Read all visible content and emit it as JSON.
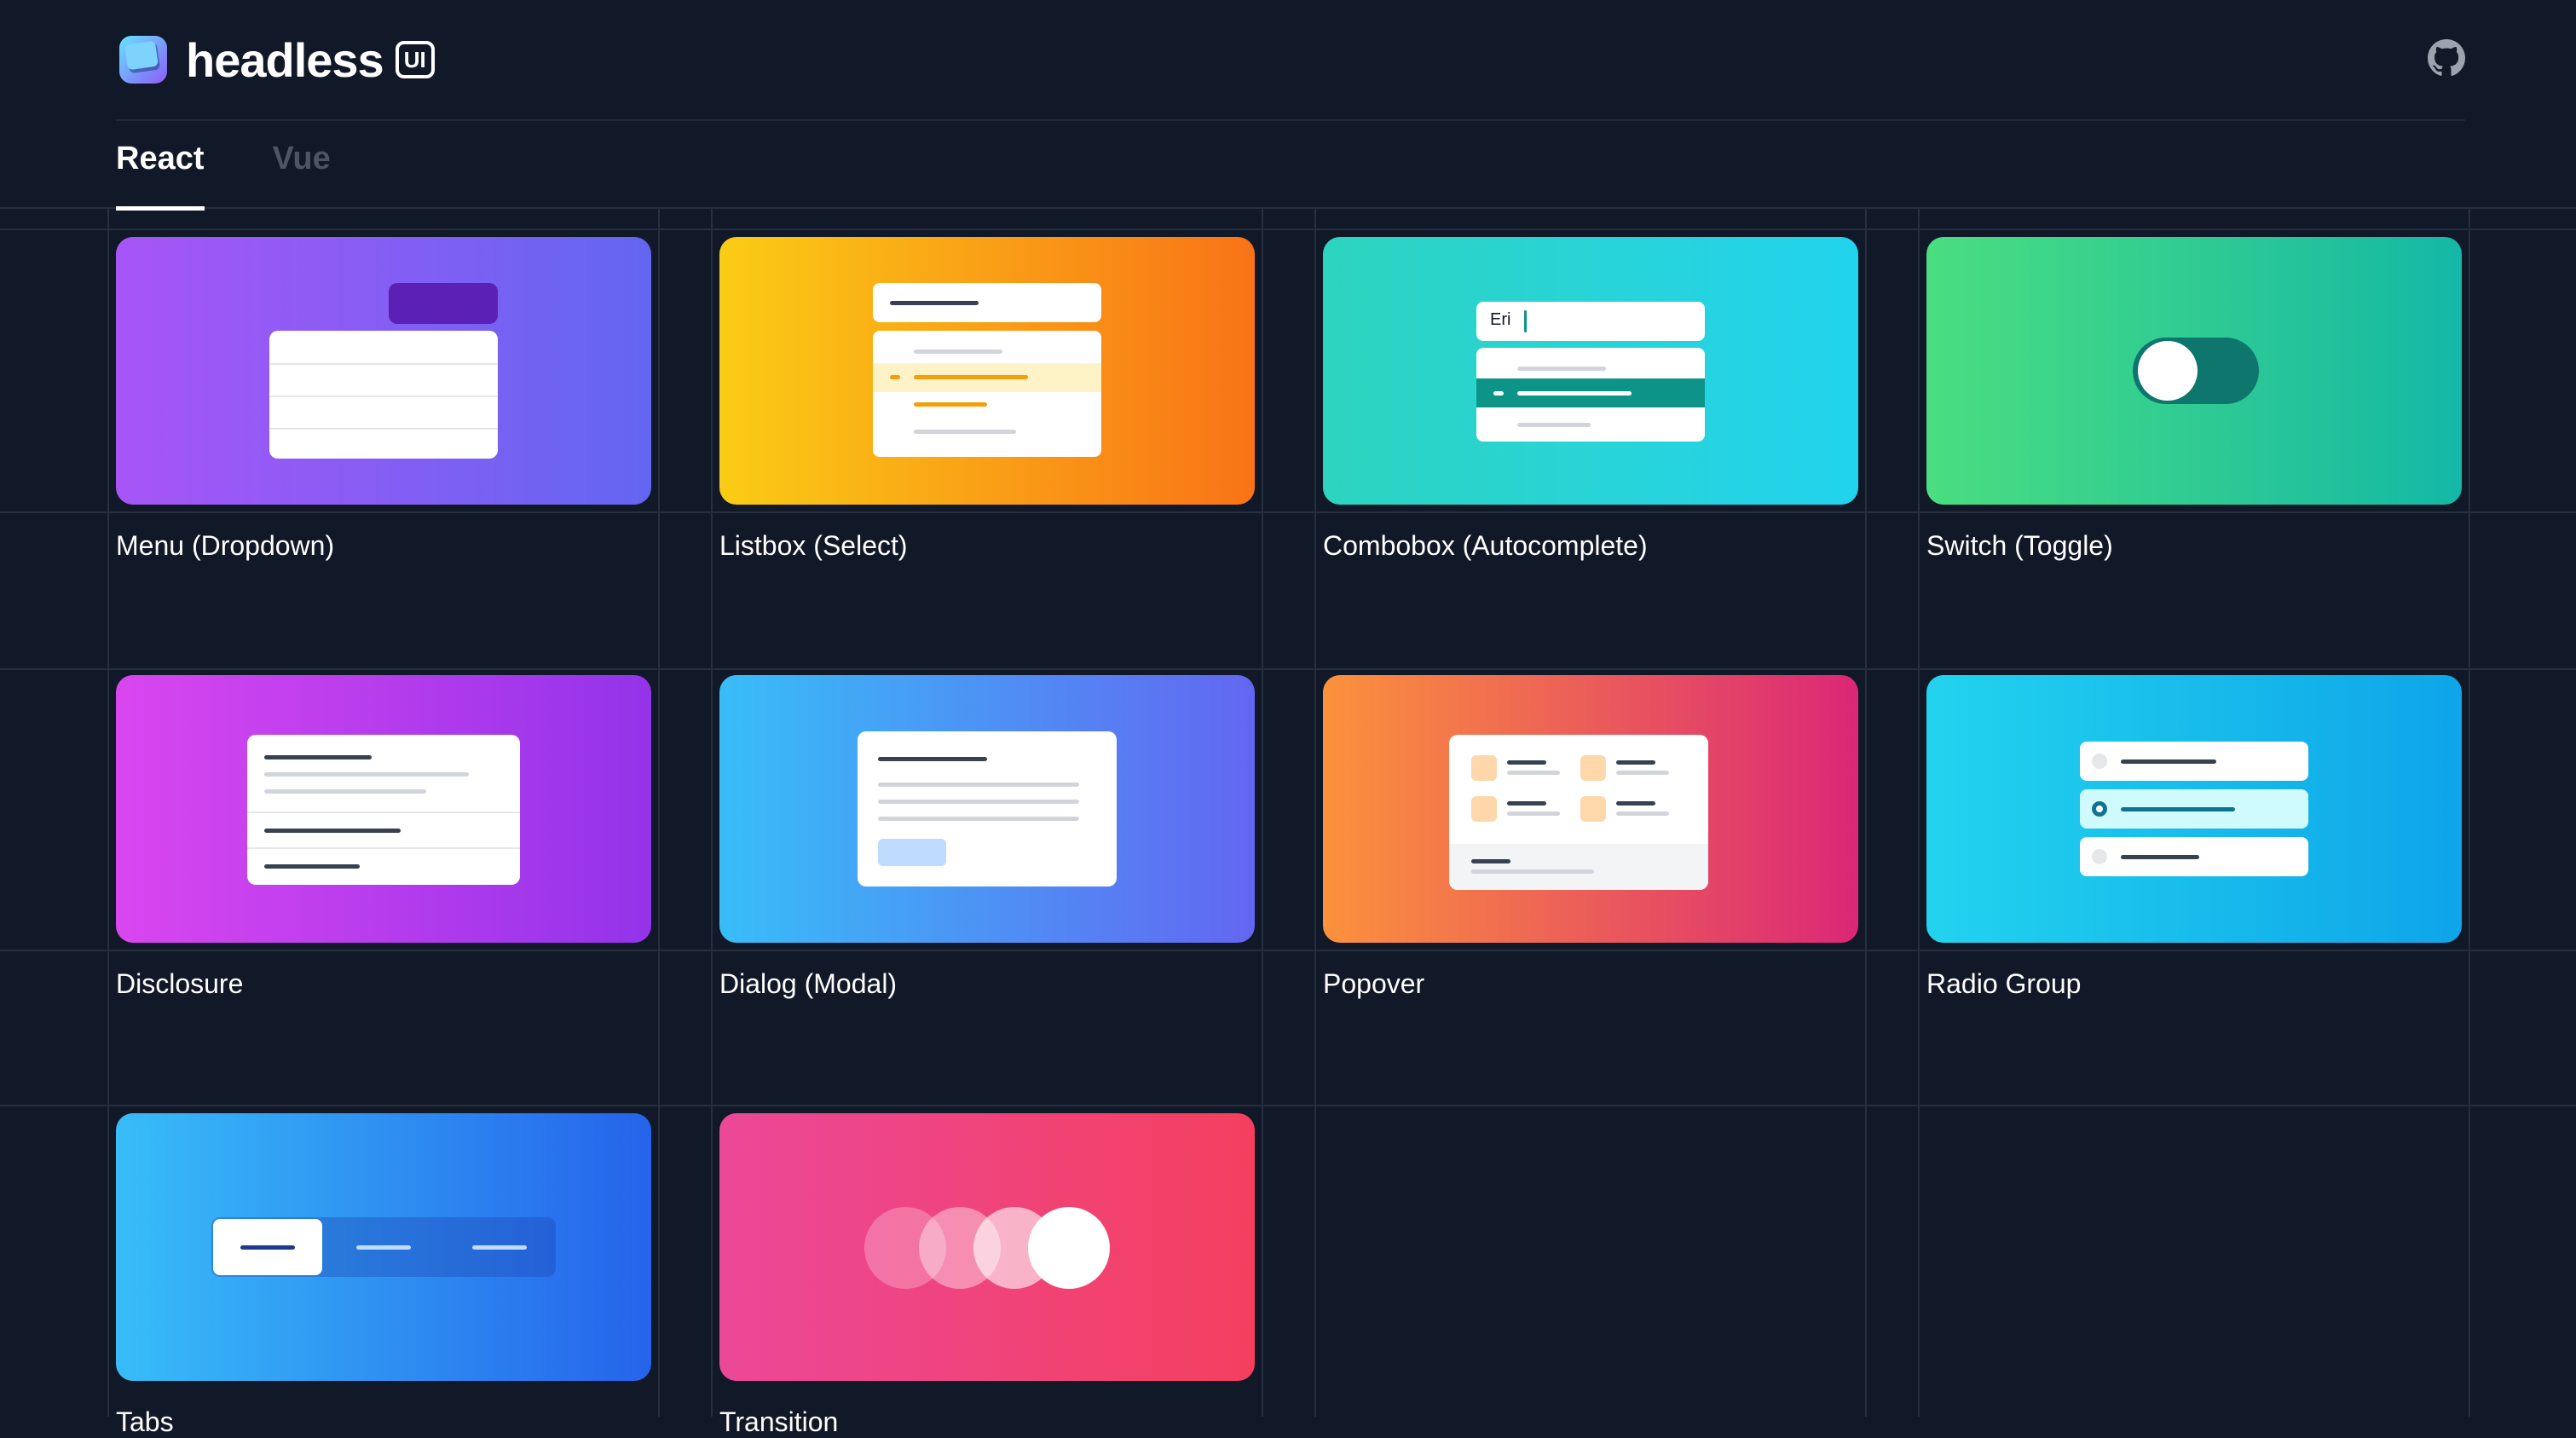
{
  "brand": {
    "name": "headless",
    "badge": "UI"
  },
  "github": {
    "icon": "github-icon"
  },
  "tabs": [
    {
      "label": "React",
      "active": true
    },
    {
      "label": "Vue",
      "active": false
    }
  ],
  "components": [
    {
      "label": "Menu (Dropdown)"
    },
    {
      "label": "Listbox (Select)"
    },
    {
      "label": "Combobox (Autocomplete)",
      "input_text": "Eri"
    },
    {
      "label": "Switch (Toggle)"
    },
    {
      "label": "Disclosure"
    },
    {
      "label": "Dialog (Modal)"
    },
    {
      "label": "Popover"
    },
    {
      "label": "Radio Group"
    },
    {
      "label": "Tabs"
    },
    {
      "label": "Transition"
    }
  ]
}
